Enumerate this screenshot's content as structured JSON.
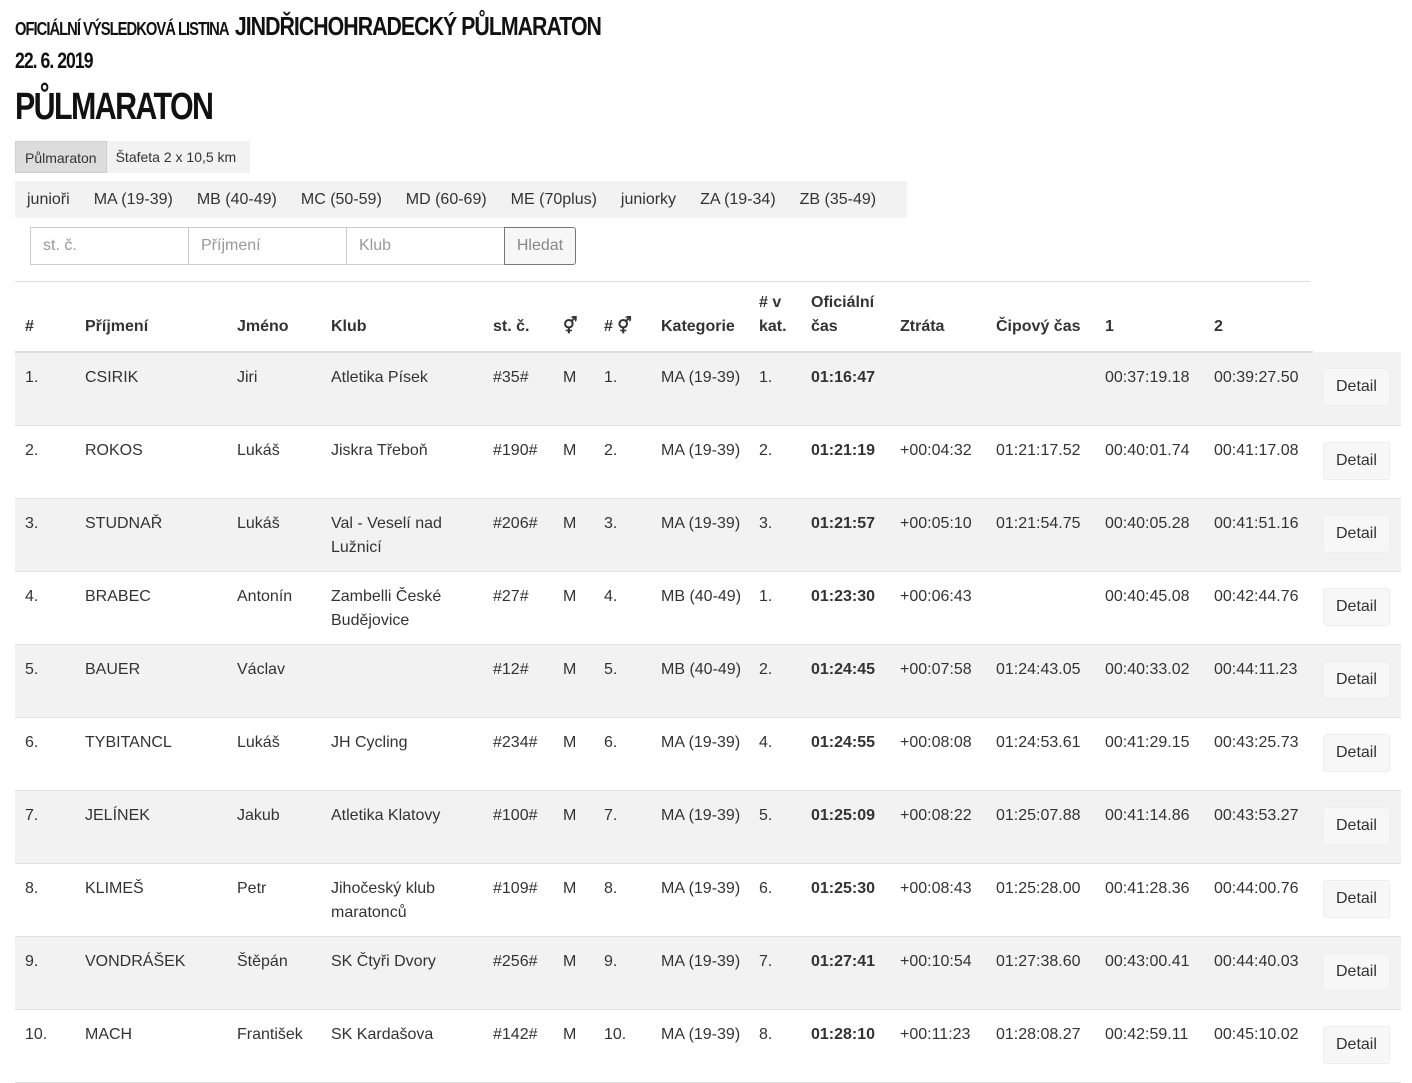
{
  "header": {
    "label": "OFICIÁLNÍ VÝSLEDKOVÁ LISTINA",
    "event": "JINDŘICHOHRADECKÝ PŮLMARATON",
    "date": "22. 6. 2019",
    "race_title": "PŮLMARATON"
  },
  "race_tabs": [
    "Půlmaraton",
    "Štafeta 2 x 10,5 km"
  ],
  "category_tabs": [
    "junioři",
    "MA (19-39)",
    "MB (40-49)",
    "MC (50-59)",
    "MD (60-69)",
    "ME (70plus)",
    "juniorky",
    "ZA (19-34)",
    "ZB (35-49)"
  ],
  "search": {
    "bib_placeholder": "st. č.",
    "surname_placeholder": "Příjmení",
    "club_placeholder": "Klub",
    "button": "Hledat"
  },
  "table": {
    "headers": {
      "rank": "#",
      "surname": "Příjmení",
      "name": "Jméno",
      "club": "Klub",
      "bib": "st. č.",
      "gender": "⚥",
      "gender_rank": "# ⚥",
      "category": "Kategorie",
      "cat_rank_1": "# v",
      "cat_rank_2": "kat.",
      "official_1": "Oficiální",
      "official_2": "čas",
      "loss": "Ztráta",
      "chip": "Čipový čas",
      "split1": "1",
      "split2": "2"
    },
    "detail_label": "Detail",
    "rows": [
      {
        "rank": "1.",
        "surname": "CSIRIK",
        "name": "Jiri",
        "club": "Atletika Písek",
        "bib": "#35#",
        "gender": "M",
        "gender_rank": "1.",
        "category": "MA (19-39)",
        "cat_rank": "1.",
        "official": "01:16:47",
        "loss": "",
        "chip": "",
        "split1": "00:37:19.18",
        "split2": "00:39:27.50"
      },
      {
        "rank": "2.",
        "surname": "ROKOS",
        "name": "Lukáš",
        "club": "Jiskra Třeboň",
        "bib": "#190#",
        "gender": "M",
        "gender_rank": "2.",
        "category": "MA (19-39)",
        "cat_rank": "2.",
        "official": "01:21:19",
        "loss": "+00:04:32",
        "chip": "01:21:17.52",
        "split1": "00:40:01.74",
        "split2": "00:41:17.08"
      },
      {
        "rank": "3.",
        "surname": "STUDNAŘ",
        "name": "Lukáš",
        "club": "Val - Veselí nad Lužnicí",
        "bib": "#206#",
        "gender": "M",
        "gender_rank": "3.",
        "category": "MA (19-39)",
        "cat_rank": "3.",
        "official": "01:21:57",
        "loss": "+00:05:10",
        "chip": "01:21:54.75",
        "split1": "00:40:05.28",
        "split2": "00:41:51.16"
      },
      {
        "rank": "4.",
        "surname": "BRABEC",
        "name": "Antonín",
        "club": "Zambelli České Budějovice",
        "bib": "#27#",
        "gender": "M",
        "gender_rank": "4.",
        "category": "MB (40-49)",
        "cat_rank": "1.",
        "official": "01:23:30",
        "loss": "+00:06:43",
        "chip": "",
        "split1": "00:40:45.08",
        "split2": "00:42:44.76"
      },
      {
        "rank": "5.",
        "surname": "BAUER",
        "name": "Václav",
        "club": "",
        "bib": "#12#",
        "gender": "M",
        "gender_rank": "5.",
        "category": "MB (40-49)",
        "cat_rank": "2.",
        "official": "01:24:45",
        "loss": "+00:07:58",
        "chip": "01:24:43.05",
        "split1": "00:40:33.02",
        "split2": "00:44:11.23"
      },
      {
        "rank": "6.",
        "surname": "TYBITANCL",
        "name": "Lukáš",
        "club": "JH Cycling",
        "bib": "#234#",
        "gender": "M",
        "gender_rank": "6.",
        "category": "MA (19-39)",
        "cat_rank": "4.",
        "official": "01:24:55",
        "loss": "+00:08:08",
        "chip": "01:24:53.61",
        "split1": "00:41:29.15",
        "split2": "00:43:25.73"
      },
      {
        "rank": "7.",
        "surname": "JELÍNEK",
        "name": "Jakub",
        "club": "Atletika Klatovy",
        "bib": "#100#",
        "gender": "M",
        "gender_rank": "7.",
        "category": "MA (19-39)",
        "cat_rank": "5.",
        "official": "01:25:09",
        "loss": "+00:08:22",
        "chip": "01:25:07.88",
        "split1": "00:41:14.86",
        "split2": "00:43:53.27"
      },
      {
        "rank": "8.",
        "surname": "KLIMEŠ",
        "name": "Petr",
        "club": "Jihočeský klub maratonců",
        "bib": "#109#",
        "gender": "M",
        "gender_rank": "8.",
        "category": "MA (19-39)",
        "cat_rank": "6.",
        "official": "01:25:30",
        "loss": "+00:08:43",
        "chip": "01:25:28.00",
        "split1": "00:41:28.36",
        "split2": "00:44:00.76"
      },
      {
        "rank": "9.",
        "surname": "VONDRÁŠEK",
        "name": "Štěpán",
        "club": "SK Čtyři Dvory",
        "bib": "#256#",
        "gender": "M",
        "gender_rank": "9.",
        "category": "MA (19-39)",
        "cat_rank": "7.",
        "official": "01:27:41",
        "loss": "+00:10:54",
        "chip": "01:27:38.60",
        "split1": "00:43:00.41",
        "split2": "00:44:40.03"
      },
      {
        "rank": "10.",
        "surname": "MACH",
        "name": "František",
        "club": "SK Kardašova",
        "bib": "#142#",
        "gender": "M",
        "gender_rank": "10.",
        "category": "MA (19-39)",
        "cat_rank": "8.",
        "official": "01:28:10",
        "loss": "+00:11:23",
        "chip": "01:28:08.27",
        "split1": "00:42:59.11",
        "split2": "00:45:10.02"
      }
    ]
  }
}
